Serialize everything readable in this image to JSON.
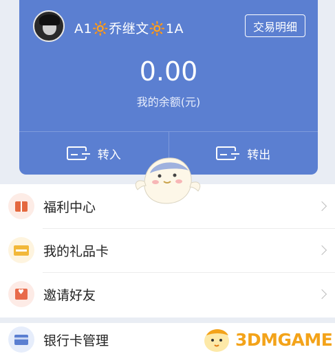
{
  "wallet": {
    "username": "A1🔆乔继文🔆1A",
    "transactions_label": "交易明细",
    "balance": "0.00",
    "balance_label": "我的余额(元)",
    "transfer_in_label": "转入",
    "transfer_out_label": "转出"
  },
  "menu": {
    "items": [
      {
        "label": "福利中心",
        "icon": "gift-icon",
        "icon_bg": "#fdece6"
      },
      {
        "label": "我的礼品卡",
        "icon": "gift-card-icon",
        "icon_bg": "#fef4df"
      },
      {
        "label": "邀请好友",
        "icon": "invite-envelope-icon",
        "icon_bg": "#fdebe6"
      }
    ],
    "bank": {
      "label": "银行卡管理",
      "icon": "bank-card-icon",
      "icon_bg": "#e6edfb"
    }
  },
  "watermark": {
    "text": "3DMGAME"
  },
  "colors": {
    "card_bg": "#5b7fd1",
    "page_bg": "#e9edf4",
    "watermark": "#f3a31a"
  }
}
